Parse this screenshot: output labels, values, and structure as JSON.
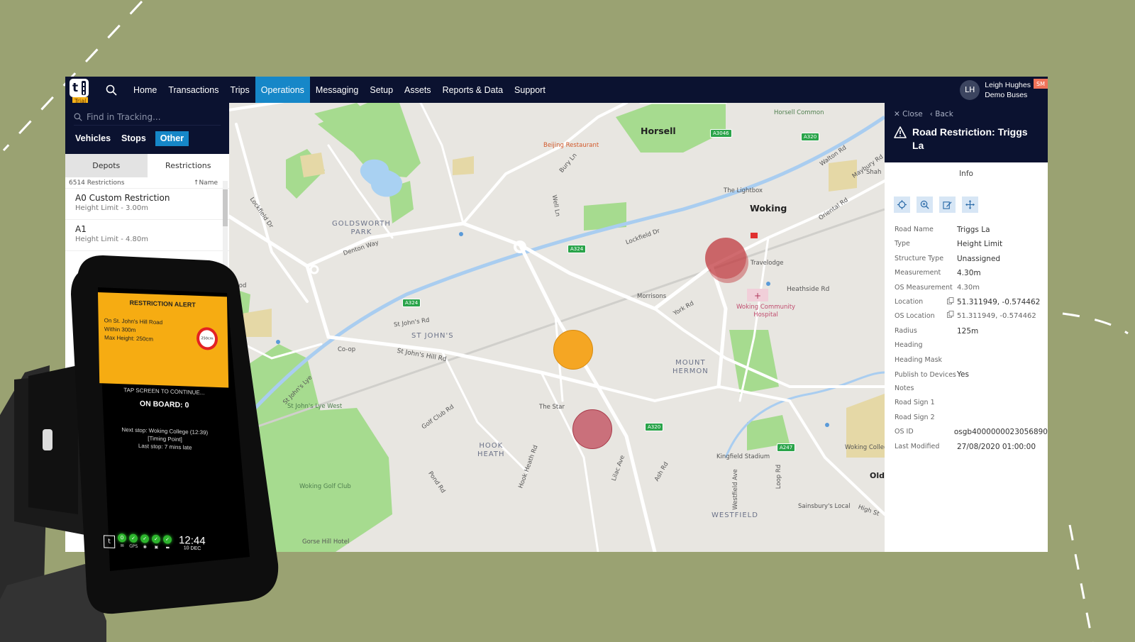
{
  "app": {
    "logo_letter": "t",
    "trial_badge": "Trial",
    "nav": [
      "Home",
      "Transactions",
      "Trips",
      "Operations",
      "Messaging",
      "Setup",
      "Assets",
      "Reports & Data",
      "Support"
    ],
    "active_nav": "Operations",
    "user": {
      "initials": "LH",
      "name": "Leigh Hughes",
      "org": "Demo Buses",
      "badge": "SM"
    }
  },
  "left_panel": {
    "search_placeholder": "Find in Tracking...",
    "type_tabs": [
      "Vehicles",
      "Stops",
      "Other"
    ],
    "active_type_tab": "Other",
    "sub_tabs": [
      "Depots",
      "Restrictions"
    ],
    "active_sub_tab": "Restrictions",
    "count_label": "6514 Restrictions",
    "sort_label": "↑Name",
    "items": [
      {
        "title": "A0 Custom Restriction",
        "subtitle": "Height Limit - 3.00m"
      },
      {
        "title": "A1",
        "subtitle": "Height Limit - 4.80m"
      }
    ]
  },
  "map": {
    "labels": {
      "horsell": "Horsell",
      "woking": "Woking",
      "goldsworth": "GOLDSWORTH\nPARK",
      "st_johns": "ST JOHN'S",
      "hook_heath": "HOOK\nHEATH",
      "mount_hermon": "MOUNT\nHERMON",
      "westfield": "WESTFIELD",
      "old": "Old",
      "beijing": "Beijing Restaurant",
      "horsell_common": "Horsell Common",
      "lightbox": "The Lightbox",
      "travelodge": "Travelodge",
      "morrisons": "Morrisons",
      "hospital": "Woking Community\nHospital",
      "heathside": "Heathside Rd",
      "york_rd": "York Rd",
      "coop": "Co-op",
      "st_johns_rd": "St John's Rd",
      "st_johns_hill": "St John's Hill Rd",
      "st_johns_lye": "St John's Lye",
      "st_johns_lye_west": "St John's Lye West",
      "golf_club_rd": "Golf Club Rd",
      "the_star": "The Star",
      "woking_golf": "Woking Golf Club",
      "gorse_hill": "Gorse Hill Hotel",
      "pond_rd": "Pond Rd",
      "hook_heath_rd": "Hook Heath Rd",
      "lilac_ave": "Lilac Ave",
      "ash_rd": "Ash Rd",
      "kingfield": "Kingfield Stadium",
      "westfield_ave": "Westfield Ave",
      "loop_rd": "Loop Rd",
      "sainsburys": "Sainsbury's Local",
      "high_st": "High St",
      "woking_college": "Woking College",
      "lockfield_dr": "Lockfield Dr",
      "lockfield_dr2": "Lockfield Dr",
      "denton_way": "Denton Way",
      "bury_ln": "Bury Ln",
      "well_ln": "Well Ln",
      "walton_rd": "Walton Rd",
      "maybury_rd": "Maybury Rd",
      "oriental_rd": "Oriental Rd",
      "shah": "Shah",
      "food": "Food"
    },
    "shields": [
      "A3046",
      "A320",
      "A324",
      "A324",
      "A320",
      "A247"
    ],
    "restrictions": [
      {
        "name": "Triggs La",
        "color": "#c0393f",
        "state": "selected"
      },
      {
        "name": "St John's Hill Rd",
        "color": "#f5a623",
        "state": "alert"
      },
      {
        "name": "Hook Heath",
        "color": "#c55060",
        "state": "normal"
      }
    ]
  },
  "right_panel": {
    "close_label": "Close",
    "back_label": "Back",
    "title": "Road Restriction: Triggs La",
    "info_tab": "Info",
    "tools": [
      "locate",
      "zoom-in",
      "edit",
      "move"
    ],
    "properties": [
      {
        "key": "Road Name",
        "value": "Triggs La"
      },
      {
        "key": "Type",
        "value": "Height Limit"
      },
      {
        "key": "Structure Type",
        "value": "Unassigned"
      },
      {
        "key": "Measurement",
        "value": "4.30m"
      },
      {
        "key": "OS Measurement",
        "value": "4.30m"
      },
      {
        "key": "Location",
        "value": "51.311949, -0.574462",
        "copy": true
      },
      {
        "key": "OS Location",
        "value": "51.311949, -0.574462",
        "copy": true
      },
      {
        "key": "Radius",
        "value": "125m"
      },
      {
        "key": "Heading",
        "value": ""
      },
      {
        "key": "Heading Mask",
        "value": ""
      },
      {
        "key": "Publish to Devices",
        "value": "Yes"
      },
      {
        "key": "Notes",
        "value": ""
      },
      {
        "key": "Road Sign 1",
        "value": ""
      },
      {
        "key": "Road Sign 2",
        "value": ""
      },
      {
        "key": "OS ID",
        "value": "osgb4000000023056890"
      },
      {
        "key": "Last Modified",
        "value": "27/08/2020 01:00:00"
      }
    ]
  },
  "device": {
    "alert_title": "RESTRICTION ALERT",
    "alert_lines": [
      "On St. John's Hill Road",
      "Within 300m",
      "Max Height: 250cm"
    ],
    "sign_text": "250cm",
    "tap_text": "TAP SCREEN TO CONTINUE...",
    "on_board": "ON BOARD: 0",
    "next_stop": "Next stop: Woking College (12:39)",
    "timing_point": "[Timing Point]",
    "last_stop": "Last stop: 7 mins late",
    "status_icons": [
      {
        "badge": "0",
        "label": "mail"
      },
      {
        "badge": "✓",
        "label": "GPS"
      },
      {
        "badge": "✓",
        "label": "signal"
      },
      {
        "badge": "✓",
        "label": "card"
      },
      {
        "badge": "✓",
        "label": "printer"
      }
    ],
    "time": "12:44",
    "date": "10 DEC"
  }
}
